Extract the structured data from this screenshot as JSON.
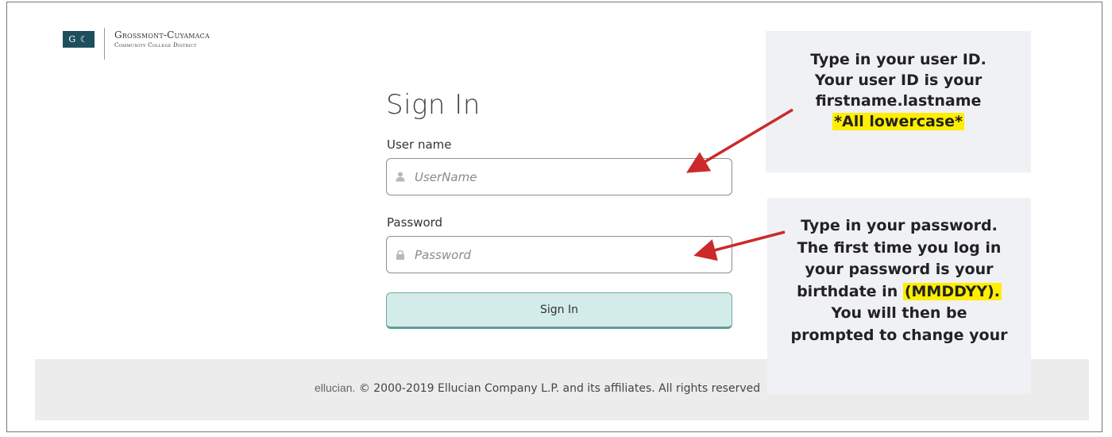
{
  "logo": {
    "mark": "G ☾",
    "line1": "Grossmont-Cuyamaca",
    "line2": "Community College District"
  },
  "signin": {
    "title": "Sign In",
    "username_label": "User name",
    "username_placeholder": "UserName",
    "password_label": "Password",
    "password_placeholder": "Password",
    "button_label": "Sign In"
  },
  "footer": {
    "brand": "ellucian.",
    "text": " © 2000-2019 Ellucian Company L.P. and its affiliates. All rights reserved."
  },
  "callouts": {
    "user": {
      "line1": "Type in your user ID.",
      "line2": "Your user ID is your",
      "line3": "firstname.lastname",
      "highlight": "*All lowercase*"
    },
    "password": {
      "line1": "Type in your password.",
      "line2": "The first time you log in",
      "line3": "your password is your",
      "line4_prefix": "birthdate in ",
      "line4_highlight": "(MMDDYY).",
      "line5": "You will then be",
      "line6": "prompted to change your"
    }
  },
  "colors": {
    "button_bg": "#d3ecea",
    "button_border": "#5f9e98",
    "callout_bg": "#f0f1f5",
    "highlight": "#ffee00",
    "arrow": "#cc2a2a",
    "footer_bg": "#ececec"
  },
  "icons": {
    "username": "user-icon",
    "password": "lock-icon"
  }
}
